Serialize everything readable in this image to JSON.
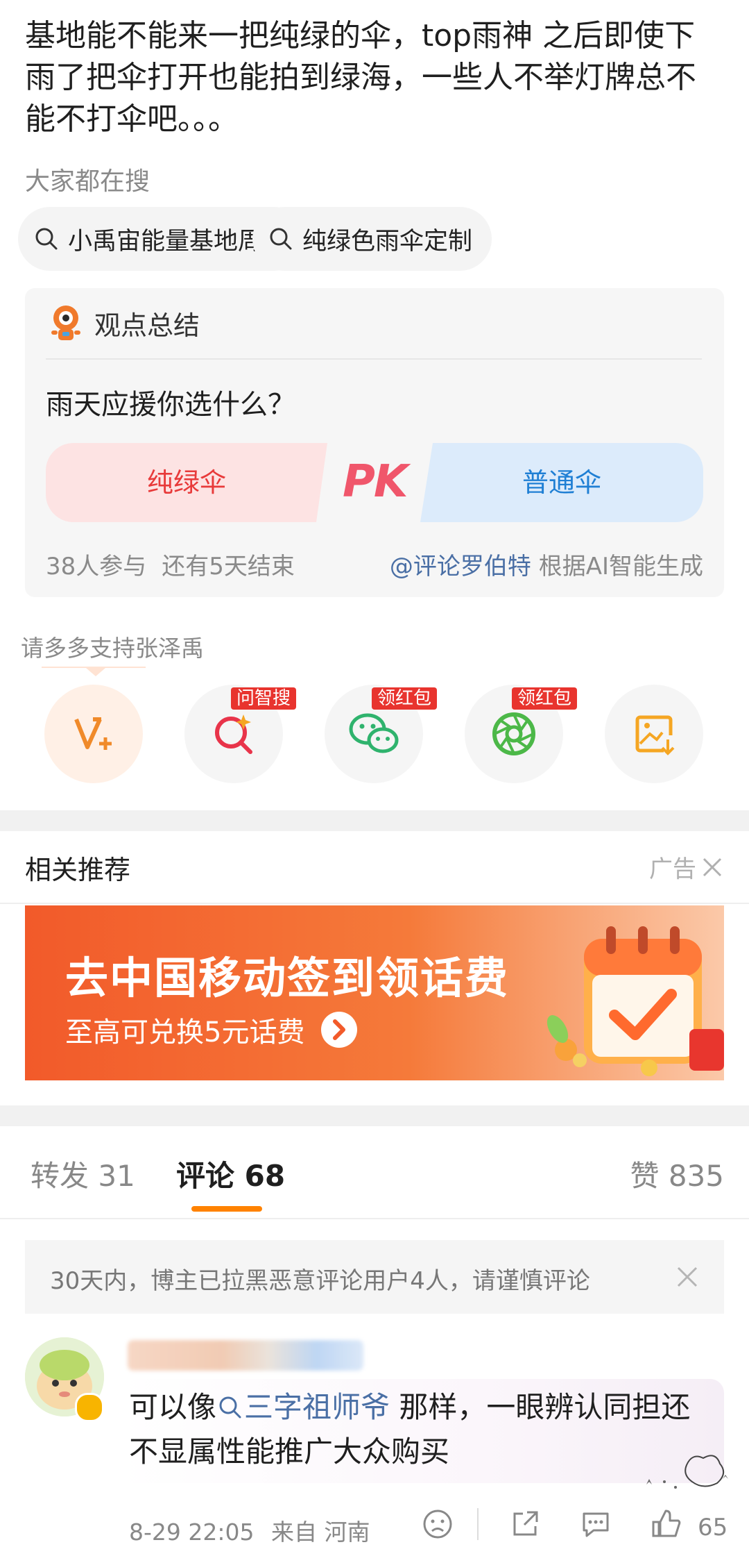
{
  "post": {
    "text": "基地能不能来一把纯绿的伞，top雨神 之后即使下雨了把伞打开也能拍到绿海，一些人不举灯牌总不能不打伞吧。。。"
  },
  "search": {
    "title": "大家都在搜",
    "chips": [
      "小禹宙能量基地周边",
      "纯绿色雨伞定制"
    ]
  },
  "viewpoint": {
    "header": "观点总结",
    "question": "雨天应援你选什么？",
    "option_left": "纯绿伞",
    "option_right": "普通伞",
    "vs": "PK",
    "participants": "38人参与",
    "remaining": "还有5天结束",
    "author": "@评论罗伯特",
    "credit": "根据AI智能生成",
    "colors": {
      "left": "#e83a3a",
      "right": "#1f7fd4",
      "left_bg": "#fde3e3",
      "right_bg": "#dcebfb"
    }
  },
  "support": {
    "text": "请多多支持张泽禹",
    "buttons": [
      {
        "icon": "vplus-icon",
        "badge": ""
      },
      {
        "icon": "ai-search-icon",
        "badge": "问智搜"
      },
      {
        "icon": "wechat-icon",
        "badge": "领红包"
      },
      {
        "icon": "moments-icon",
        "badge": "领红包"
      },
      {
        "icon": "save-image-icon",
        "badge": ""
      }
    ]
  },
  "related": {
    "title": "相关推荐",
    "ad_label": "广告",
    "banner_title": "去中国移动签到领话费",
    "banner_sub": "至高可兑换5元话费"
  },
  "tabs": {
    "repost": "转发 31",
    "comments": "评论 68",
    "likes": "赞 835"
  },
  "notice": {
    "text": "30天内，博主已拉黑恶意评论用户4人，请谨慎评论"
  },
  "comment": {
    "text_before": "可以像",
    "link": "三字祖师爷",
    "text_after": " 那样，一眼辨认同担还不显属性能推广大众购买",
    "time": "8-29 22:05",
    "location": "来自 河南",
    "like_count": "65"
  },
  "colors": {
    "accent": "#ff8200",
    "link": "#4a6fa5",
    "badge": "#e8342e"
  }
}
